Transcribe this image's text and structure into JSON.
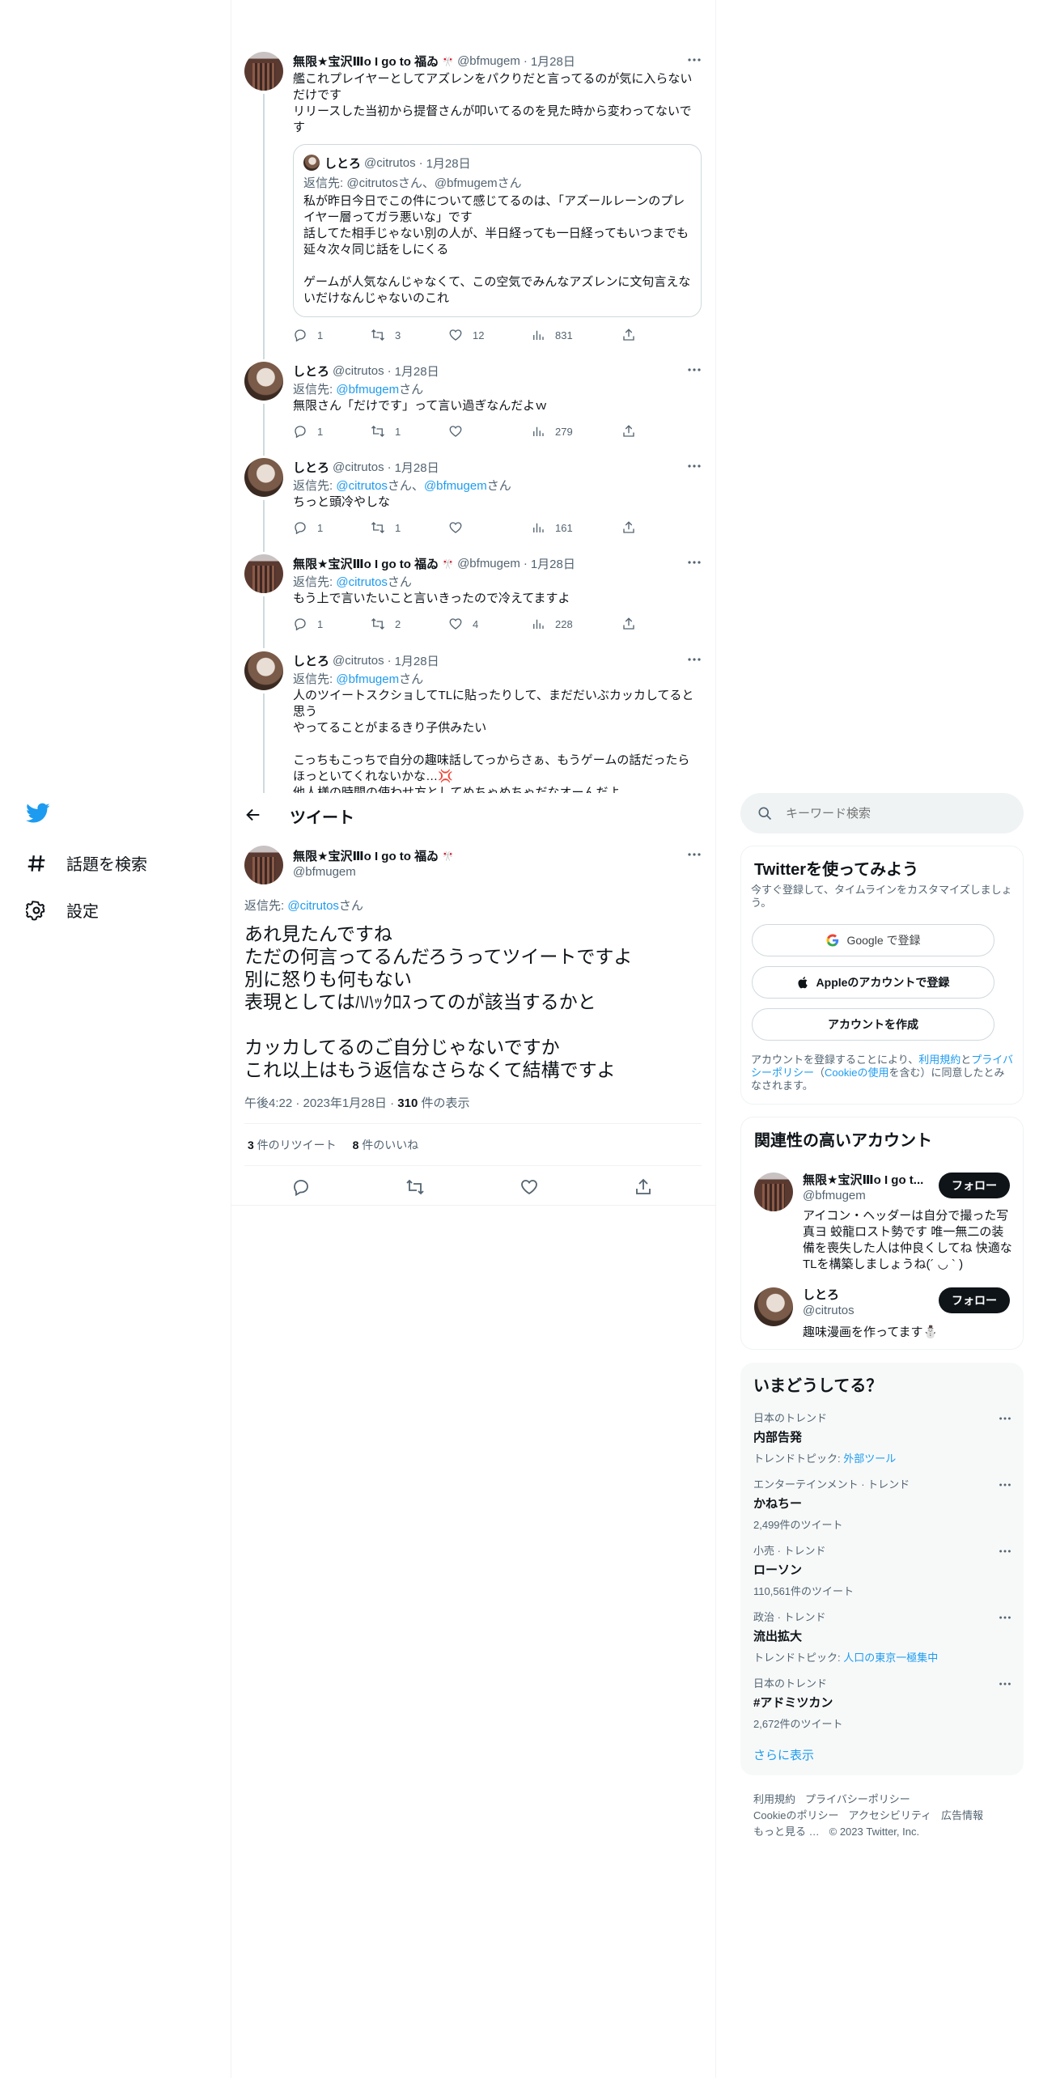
{
  "nav": {
    "items": [
      {
        "label": "話題を検索",
        "icon": "hashtag-icon"
      },
      {
        "label": "設定",
        "icon": "gear-icon"
      }
    ]
  },
  "thread": [
    {
      "name": "無限★宝沢Ⅲo I go to 福ゐ",
      "handle": "@bfmugem",
      "time": "1月28日",
      "text": "艦これプレイヤーとしてアズレンをパクりだと言ってるのが気に入らないだけです\nリリースした当初から提督さんが叩いてるのを見た時から変わってないです",
      "quote": {
        "name": "しとろ",
        "handle": "@citrutos",
        "time": "1月28日",
        "reply_prefix": "返信先: ",
        "reply_to": "@citrutosさん、@bfmugemさん",
        "text": "私が昨日今日でこの件について感じてるのは、「アズールレーンのプレイヤー層ってガラ悪いな」です\n話してた相手じゃない別の人が、半日経っても一日経ってもいつまでも延々次々同じ話をしにくる\n\nゲームが人気なんじゃなくて、この空気でみんなアズレンに文句言えないだけなんじゃないのこれ"
      },
      "replies": "1",
      "retweets": "3",
      "likes": "12",
      "views": "831"
    },
    {
      "name": "しとろ",
      "handle": "@citrutos",
      "time": "1月28日",
      "reply_prefix": "返信先: ",
      "reply_links": [
        "@bfmugem"
      ],
      "reply_suffix": "さん",
      "text": "無限さん「だけです」って言い過ぎなんだよｗ",
      "replies": "1",
      "retweets": "1",
      "likes": "",
      "views": "279"
    },
    {
      "name": "しとろ",
      "handle": "@citrutos",
      "time": "1月28日",
      "reply_prefix": "返信先: ",
      "reply_links": [
        "@citrutos",
        "@bfmugem"
      ],
      "reply_suffix": "さん",
      "text": "ちっと頭冷やしな",
      "replies": "1",
      "retweets": "1",
      "likes": "",
      "views": "161"
    },
    {
      "name": "無限★宝沢Ⅲo I go to 福ゐ",
      "handle": "@bfmugem",
      "time": "1月28日",
      "reply_prefix": "返信先: ",
      "reply_links": [
        "@citrutos"
      ],
      "reply_suffix": "さん",
      "text": "もう上で言いたいこと言いきったので冷えてますよ",
      "replies": "1",
      "retweets": "2",
      "likes": "4",
      "views": "228"
    },
    {
      "name": "しとろ",
      "handle": "@citrutos",
      "time": "1月28日",
      "reply_prefix": "返信先: ",
      "reply_links": [
        "@bfmugem"
      ],
      "reply_suffix": "さん",
      "text": "人のツイートスクショしてTLに貼ったりして、まだだいぶカッカしてると思う\nやってることがまるきり子供みたい\n\nこっちもこっちで自分の趣味話してっからさぁ、もうゲームの話だったらほっといてくれないかな…💢\n他人様の時間の使わせ方としてめちゃめちゃだなオーんだよ"
    }
  ],
  "header": {
    "title": "ツイート"
  },
  "main_tweet": {
    "name": "無限★宝沢Ⅲo I go to 福ゐ",
    "handle": "@bfmugem",
    "reply_prefix": "返信先: ",
    "reply_to": "@citrutos",
    "reply_suffix": "さん",
    "text": "あれ見たんですね\nただの何言ってるんだろうってツイートですよ\n別に怒りも何もない\n表現としてはﾊﾊｯｸﾛｽってのが該当するかと\n\nカッカしてるのご自分じゃないですか\nこれ以上はもう返信なさらなくて結構ですよ",
    "timestamp": "午後4:22 · 2023年1月28日 · ",
    "views": "310",
    "views_label": " 件の表示",
    "retweets": "3",
    "retweets_label": " 件のリツイート",
    "likes": "8",
    "likes_label": " 件のいいね"
  },
  "search": {
    "placeholder": "キーワード検索"
  },
  "signup": {
    "title": "Twitterを使ってみよう",
    "desc": "今すぐ登録して、タイムラインをカスタマイズしましょう。",
    "google": "Google で登録",
    "apple": "Appleのアカウントで登録",
    "create": "アカウントを作成",
    "legal_1": "アカウントを登録することにより、",
    "legal_terms": "利用規約",
    "legal_2": "と",
    "legal_privacy": "プライバシーポリシー",
    "legal_3": "（",
    "legal_cookie": "Cookieの使用",
    "legal_4": "を含む）に同意したとみなされます。"
  },
  "related": {
    "title": "関連性の高いアカウント",
    "follow_label": "フォロー",
    "accounts": [
      {
        "name": "無限★宝沢Ⅲo I go t...",
        "handle": "@bfmugem",
        "bio": "アイコン・ヘッダーは自分で撮った写真ヨ 蛟龍ロスト勢です 唯一無二の装備を喪失した人は仲良くしてね 快適なTLを構築しましょうね(´ ◡ ` )"
      },
      {
        "name": "しとろ",
        "handle": "@citrutos",
        "bio": "趣味漫画を作ってます⛄"
      }
    ]
  },
  "trends": {
    "title": "いまどうしてる？",
    "items": [
      {
        "category": "日本のトレンド",
        "name": "内部告発",
        "sub_prefix": "トレンドトピック: ",
        "sub_link": "外部ツール"
      },
      {
        "category": "エンターテインメント · トレンド",
        "name": "かねちー",
        "sub": "2,499件のツイート"
      },
      {
        "category": "小売 · トレンド",
        "name": "ローソン",
        "sub": "110,561件のツイート"
      },
      {
        "category": "政治 · トレンド",
        "name": "流出拡大",
        "sub_prefix": "トレンドトピック: ",
        "sub_link": "人口の東京一極集中"
      },
      {
        "category": "日本のトレンド",
        "name": "#アドミツカン",
        "sub": "2,672件のツイート"
      }
    ],
    "show_more": "さらに表示"
  },
  "footer": {
    "row1": [
      "利用規約",
      "プライバシーポリシー"
    ],
    "row2": [
      "Cookieのポリシー",
      "アクセシビリティ",
      "広告情報"
    ],
    "row3": [
      "もっと見る …",
      "© 2023 Twitter, Inc."
    ]
  },
  "colors": {
    "accent": "#1d9bf0",
    "text": "#0f1419",
    "secondary": "#536471",
    "border": "#eff3f4"
  }
}
